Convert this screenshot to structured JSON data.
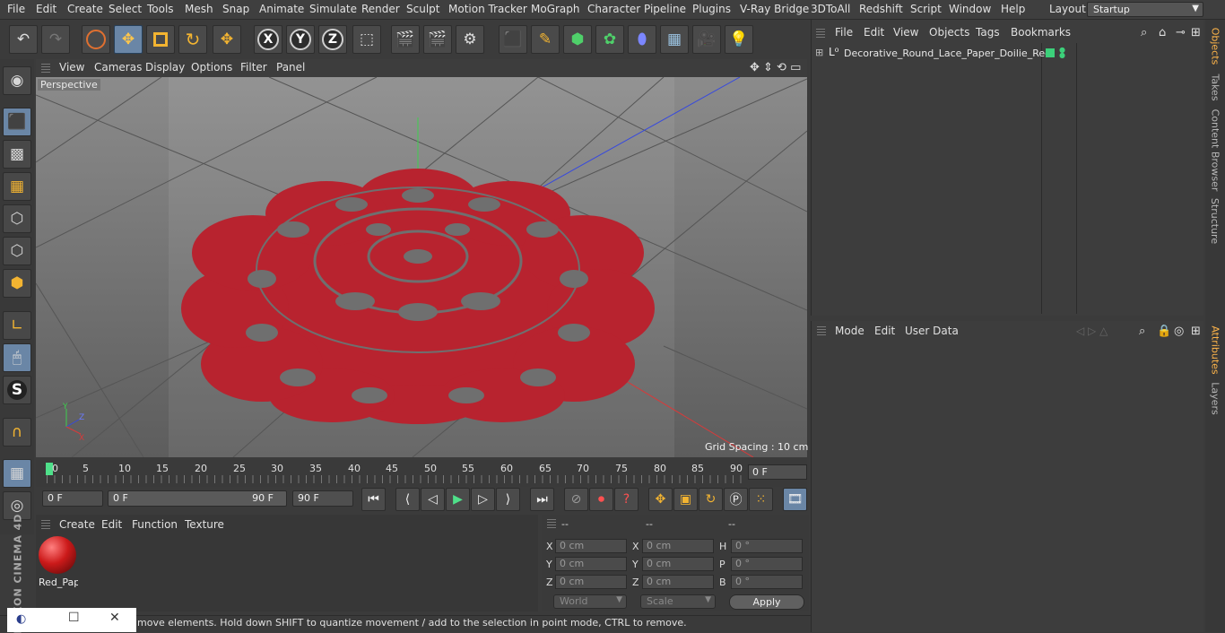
{
  "menubar": {
    "items": [
      "File",
      "Edit",
      "Create",
      "Select",
      "Tools",
      "Mesh",
      "Snap",
      "Animate",
      "Simulate",
      "Render",
      "Sculpt",
      "Motion Tracker",
      "MoGraph",
      "Character",
      "Pipeline",
      "Plugins",
      "V-Ray Bridge",
      "3DToAll",
      "Redshift",
      "Script",
      "Window",
      "Help"
    ],
    "layout_label": "Layout:",
    "layout_value": "Startup"
  },
  "viewport": {
    "menu": [
      "View",
      "Cameras",
      "Display",
      "Options",
      "Filter",
      "Panel"
    ],
    "label": "Perspective",
    "grid_spacing": "Grid Spacing : 10 cm"
  },
  "timeline": {
    "ticks": [
      "0",
      "5",
      "10",
      "15",
      "20",
      "25",
      "30",
      "35",
      "40",
      "45",
      "50",
      "55",
      "60",
      "65",
      "70",
      "75",
      "80",
      "85",
      "90"
    ],
    "current_frame": "0 F",
    "start_field": "0 F",
    "range_start": "0 F",
    "range_end": "90 F",
    "end_field": "90 F"
  },
  "material_panel": {
    "menu": [
      "Create",
      "Edit",
      "Function",
      "Texture"
    ],
    "material_name": "Red_Pap"
  },
  "coordinates": {
    "headers": [
      "--",
      "--",
      "--"
    ],
    "rows": [
      {
        "l1": "X",
        "v1": "0 cm",
        "l2": "X",
        "v2": "0 cm",
        "l3": "H",
        "v3": "0 °"
      },
      {
        "l1": "Y",
        "v1": "0 cm",
        "l2": "Y",
        "v2": "0 cm",
        "l3": "P",
        "v3": "0 °"
      },
      {
        "l1": "Z",
        "v1": "0 cm",
        "l2": "Z",
        "v2": "0 cm",
        "l3": "B",
        "v3": "0 °"
      }
    ],
    "world_dropdown": "World",
    "scale_dropdown": "Scale",
    "apply_label": "Apply"
  },
  "status": {
    "text": "move elements. Hold down SHIFT to quantize movement / add to the selection in point mode, CTRL to remove."
  },
  "branding": {
    "logo": "MAXON CINEMA 4D"
  },
  "objects_panel": {
    "menu": [
      "File",
      "Edit",
      "View",
      "Objects",
      "Tags",
      "Bookmarks"
    ],
    "object_name": "Decorative_Round_Lace_Paper_Doilie_Red"
  },
  "attributes_panel": {
    "menu": [
      "Mode",
      "Edit",
      "User Data"
    ]
  },
  "right_tabs": [
    "Objects",
    "Takes",
    "Content Browser",
    "Structure",
    "Attributes",
    "Layers"
  ],
  "colors": {
    "doily_red": "#b8232f",
    "accent_blue": "#6a86a6",
    "active_tab": "#ffb54a"
  },
  "icons": {
    "toolbar": [
      "undo-icon",
      "redo-icon",
      "live-selection-icon",
      "move-icon",
      "scale-icon",
      "rotate-icon",
      "recent-tool-icon",
      "x-axis-icon",
      "y-axis-icon",
      "z-axis-icon",
      "world-coords-icon",
      "render-view-icon",
      "render-picture-viewer-icon",
      "render-settings-icon",
      "cube-icon",
      "pen-icon",
      "subdivision-icon",
      "mograph-cloner-icon",
      "deformer-icon",
      "floor-icon",
      "camera-icon",
      "light-icon"
    ]
  }
}
